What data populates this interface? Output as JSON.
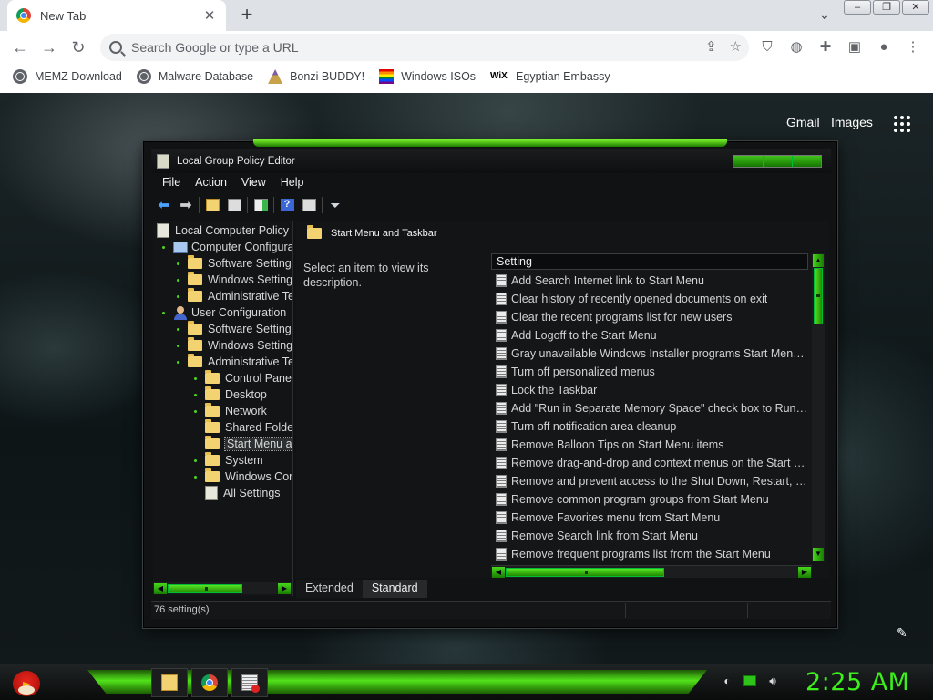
{
  "browser": {
    "tab": {
      "title": "New Tab",
      "close": "✕"
    },
    "new_tab": "+",
    "omnibox": {
      "placeholder": "Search Google or type a URL"
    },
    "bookmarks": [
      {
        "label": "MEMZ Download",
        "icon": "globe-icon"
      },
      {
        "label": "Malware Database",
        "icon": "globe-icon"
      },
      {
        "label": "Bonzi BUDDY!",
        "icon": "bonzi-icon"
      },
      {
        "label": "Windows ISOs",
        "icon": "rainbow-icon"
      },
      {
        "label": "Egyptian Embassy",
        "icon": "wix-icon",
        "icon_text": "WiX"
      }
    ]
  },
  "google": {
    "gmail": "Gmail",
    "images": "Images"
  },
  "gpedit": {
    "title": "Local Group Policy Editor",
    "menu": [
      "File",
      "Action",
      "View",
      "Help"
    ],
    "tree": [
      {
        "label": "Local Computer Policy",
        "level": 0,
        "icon": "policy",
        "dot": false
      },
      {
        "label": "Computer Configuration",
        "level": 1,
        "icon": "pc",
        "dot": true
      },
      {
        "label": "Software Settings",
        "level": 2,
        "icon": "folder",
        "dot": true
      },
      {
        "label": "Windows Settings",
        "level": 2,
        "icon": "folder",
        "dot": true
      },
      {
        "label": "Administrative Templates",
        "level": 2,
        "icon": "folder",
        "dot": true
      },
      {
        "label": "User Configuration",
        "level": 1,
        "icon": "user",
        "dot": true
      },
      {
        "label": "Software Settings",
        "level": 2,
        "icon": "folder",
        "dot": true
      },
      {
        "label": "Windows Settings",
        "level": 2,
        "icon": "folder",
        "dot": true
      },
      {
        "label": "Administrative Templates",
        "level": 2,
        "icon": "folder",
        "dot": true
      },
      {
        "label": "Control Panel",
        "level": 3,
        "icon": "folder",
        "dot": true
      },
      {
        "label": "Desktop",
        "level": 3,
        "icon": "folder",
        "dot": true
      },
      {
        "label": "Network",
        "level": 3,
        "icon": "folder",
        "dot": true
      },
      {
        "label": "Shared Folders",
        "level": 3,
        "icon": "folder",
        "dot": false
      },
      {
        "label": "Start Menu and Taskbar",
        "level": 3,
        "icon": "folder",
        "dot": false,
        "selected": true
      },
      {
        "label": "System",
        "level": 3,
        "icon": "folder",
        "dot": true
      },
      {
        "label": "Windows Components",
        "level": 3,
        "icon": "folder",
        "dot": true
      },
      {
        "label": "All Settings",
        "level": 3,
        "icon": "policy",
        "dot": false
      }
    ],
    "right_header": "Start Menu and Taskbar",
    "description": "Select an item to view its description.",
    "column_header": "Setting",
    "settings": [
      "Add Search Internet link to Start Menu",
      "Clear history of recently opened documents on exit",
      "Clear the recent programs list for new users",
      "Add Logoff to the Start Menu",
      "Gray unavailable Windows Installer programs Start Menu shortcuts",
      "Turn off personalized menus",
      "Lock the Taskbar",
      "Add \"Run in Separate Memory Space\" check box to Run dialog box",
      "Turn off notification area cleanup",
      "Remove Balloon Tips on Start Menu items",
      "Remove drag-and-drop and context menus on the Start Menu",
      "Remove and prevent access to the Shut Down, Restart, Sleep, and Hibernate commands",
      "Remove common program groups from Start Menu",
      "Remove Favorites menu from Start Menu",
      "Remove Search link from Start Menu",
      "Remove frequent programs list from the Start Menu"
    ],
    "tabs": [
      "Extended",
      "Standard"
    ],
    "active_tab": "Standard",
    "status": "76 setting(s)"
  },
  "taskbar": {
    "clock": "2:25 AM"
  }
}
